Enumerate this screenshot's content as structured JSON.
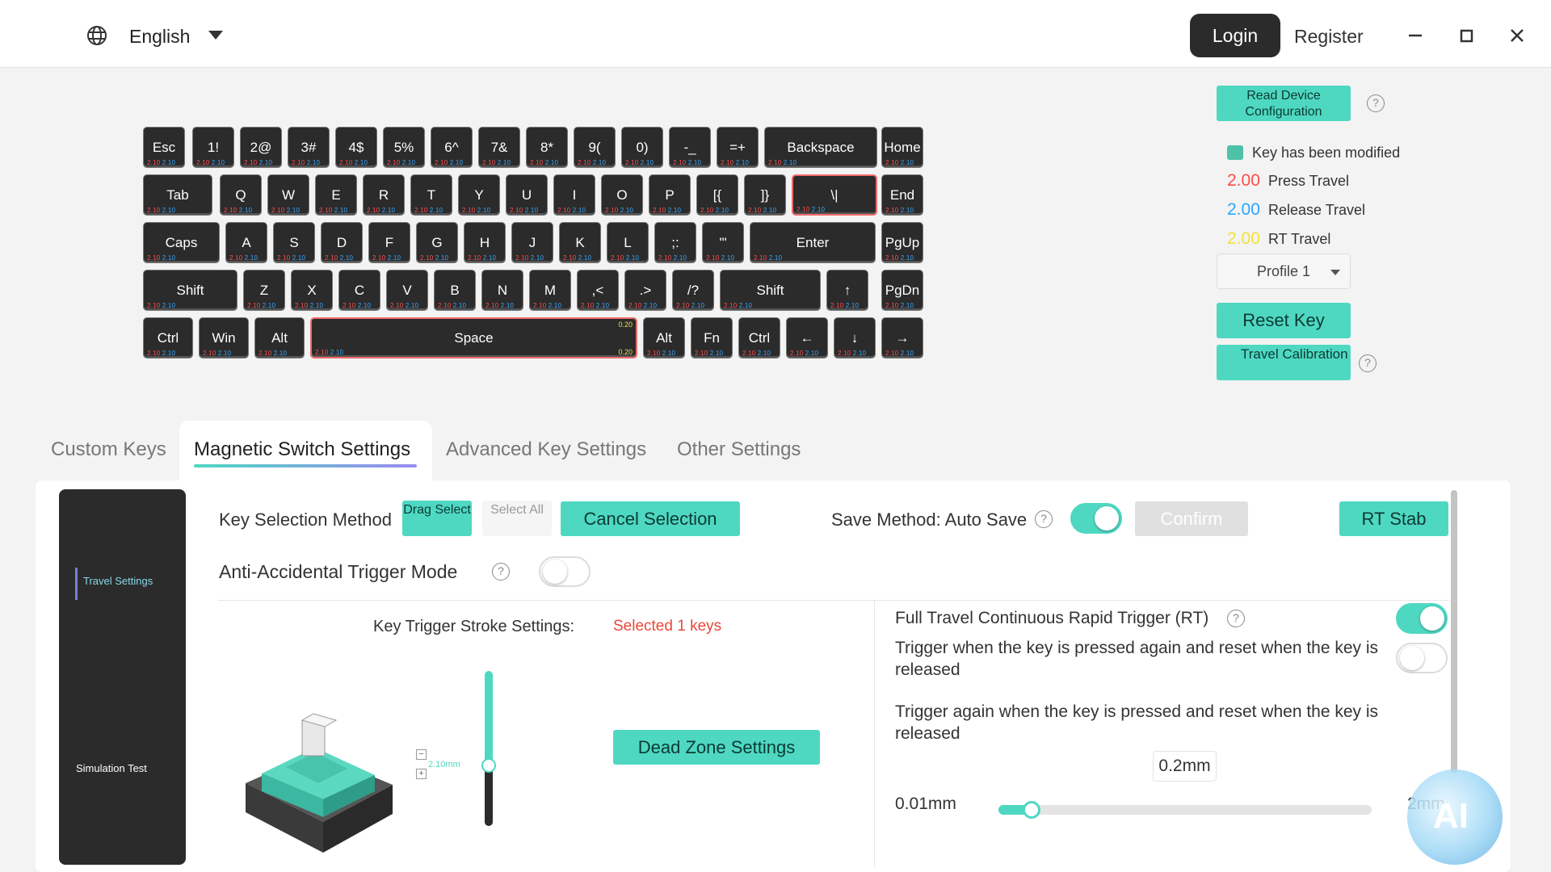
{
  "header": {
    "language": "English",
    "login": "Login",
    "register": "Register"
  },
  "keyboard": {
    "travel_press": "2.10",
    "travel_release": "2.10",
    "space_rt": "0.20",
    "rows": [
      [
        "Esc",
        "1!",
        "2@",
        "3#",
        "4$",
        "5%",
        "6^",
        "7&",
        "8*",
        "9(",
        "0)",
        "-_",
        "=+",
        "Backspace",
        "Home"
      ],
      [
        "Tab",
        "Q",
        "W",
        "E",
        "R",
        "T",
        "Y",
        "U",
        "I",
        "O",
        "P",
        "[{",
        "]}",
        "\\|",
        "End"
      ],
      [
        "Caps",
        "A",
        "S",
        "D",
        "F",
        "G",
        "H",
        "J",
        "K",
        "L",
        ";:",
        "'\"",
        "Enter",
        "PgUp"
      ],
      [
        "Shift",
        "Z",
        "X",
        "C",
        "V",
        "B",
        "N",
        "M",
        ",<",
        ".>",
        "/?",
        "Shift",
        "↑",
        "PgDn"
      ],
      [
        "Ctrl",
        "Win",
        "Alt",
        "Space",
        "Alt",
        "Fn",
        "Ctrl",
        "←",
        "↓",
        "→"
      ]
    ]
  },
  "right_panel": {
    "read_config": "Read Device Configuration",
    "legend": {
      "modified": "Key has been modified",
      "press_value": "2.00",
      "press_label": "Press Travel",
      "release_value": "2.00",
      "release_label": "Release Travel",
      "rt_value": "2.00",
      "rt_label": "RT Travel"
    },
    "profile": "Profile 1",
    "reset_key": "Reset Key",
    "travel_calibration": "Travel Calibration",
    "colors": {
      "press": "#ff4a4a",
      "release": "#2aa7ff",
      "rt": "#f2e23a",
      "accent": "#4ed8c2"
    }
  },
  "tabs": [
    "Custom Keys",
    "Magnetic Switch Settings",
    "Advanced Key Settings",
    "Other Settings"
  ],
  "sidebar": {
    "items": [
      "Travel Settings",
      "Simulation Test"
    ]
  },
  "settings": {
    "key_selection_method": "Key Selection Method",
    "drag_select": "Drag Select",
    "select_all": "Select All",
    "cancel_selection": "Cancel Selection",
    "save_method": "Save Method: Auto Save",
    "confirm": "Confirm",
    "rt_stab": "RT Stab",
    "anti_accidental": "Anti-Accidental Trigger Mode",
    "stroke_title": "Key Trigger Stroke Settings:",
    "selected": "Selected 1 keys",
    "switch_value": "2.10mm",
    "dead_zone": "Dead Zone Settings",
    "full_travel_rt": "Full Travel Continuous Rapid Trigger (RT)",
    "trigger_pressed_again": "Trigger when the key is pressed again and reset when the key is released",
    "trigger_again": "Trigger again when the key is pressed and reset when the key is released",
    "rt_value": "0.2mm",
    "min": "0.01mm",
    "max": "2mm",
    "rt_slider_fraction": 0.095,
    "save_toggle_on": true,
    "anti_toggle_on": false,
    "full_rt_on": true,
    "pressed_again_on": false
  },
  "ai_badge": "AI"
}
